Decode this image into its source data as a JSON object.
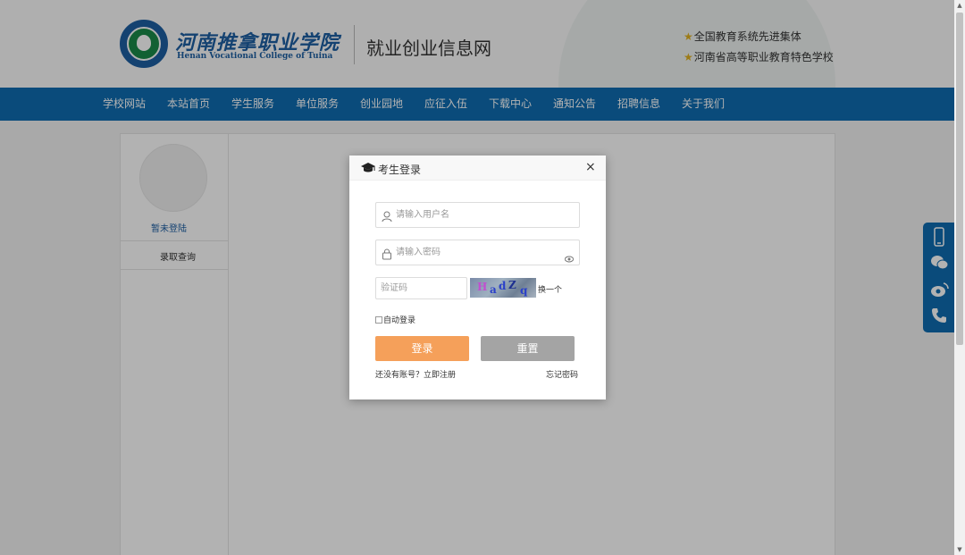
{
  "header": {
    "logo_cn": "河南推拿职业学院",
    "logo_en": "Henan Vocational College of Tuina",
    "site_title": "就业创业信息网",
    "honors": [
      "全国教育系统先进集体",
      "河南省高等职业教育特色学校"
    ]
  },
  "nav": {
    "items": [
      "学校网站",
      "本站首页",
      "学生服务",
      "单位服务",
      "创业园地",
      "应征入伍",
      "下载中心",
      "通知公告",
      "招聘信息",
      "关于我们"
    ]
  },
  "sidebar": {
    "login_state": "暂未登陆",
    "link": "录取查询"
  },
  "modal": {
    "title": "考生登录",
    "close": "×",
    "username_placeholder": "请输入用户名",
    "password_placeholder": "请输入密码",
    "captcha_placeholder": "验证码",
    "captcha_text": [
      "H",
      "a",
      "d",
      "Z",
      "q"
    ],
    "captcha_refresh": "换一个",
    "remember": "自动登录",
    "login_button": "登录",
    "reset_button": "重置",
    "register": "还没有账号？立即注册",
    "forgot": "忘记密码"
  },
  "float_bar": {
    "icons": [
      "mobile-icon",
      "wechat-icon",
      "weibo-icon",
      "phone-icon"
    ]
  },
  "colors": {
    "nav_bg": "#0f6cb0",
    "brand_blue": "#1d5fa3",
    "login_button": "#f5a05a",
    "reset_button": "#a4a4a4",
    "star": "#e0b020"
  }
}
